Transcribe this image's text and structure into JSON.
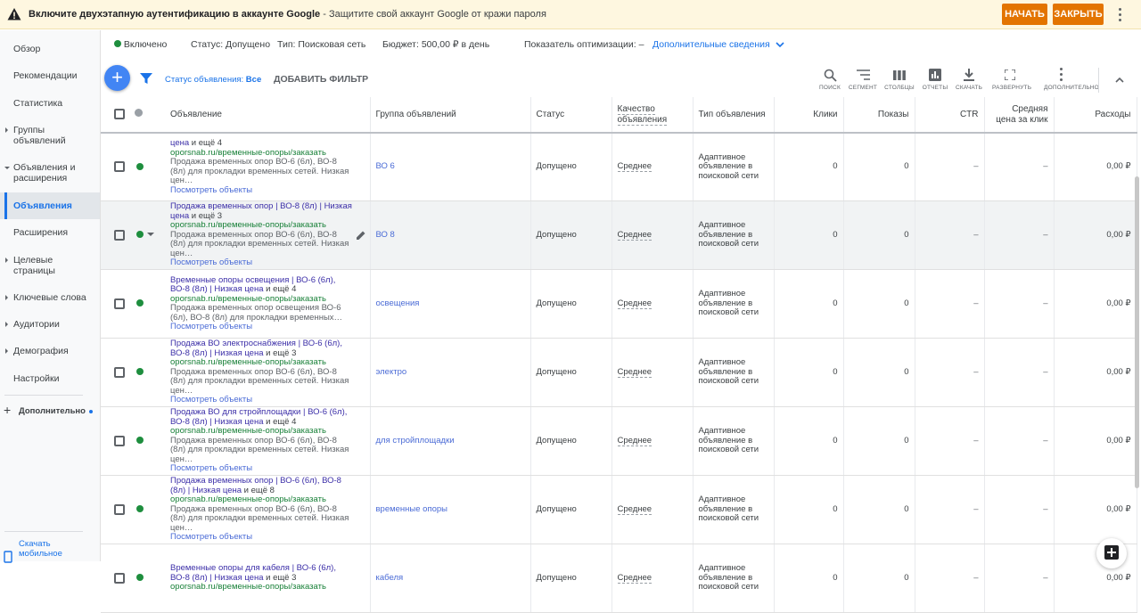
{
  "banner": {
    "title": "Включите двухэтапную аутентификацию в аккаунте Google",
    "text": " - Защитите свой аккаунт Google от кражи пароля",
    "start": "НАЧАТЬ",
    "close": "ЗАКРЫТЬ"
  },
  "sidebar": {
    "items": [
      {
        "label": "Обзор"
      },
      {
        "label": "Рекомендации"
      },
      {
        "label": "Статистика"
      },
      {
        "label": "Группы объявлений"
      },
      {
        "label": "Объявления и расширения"
      },
      {
        "label": "Объявления"
      },
      {
        "label": "Расширения"
      },
      {
        "label": "Целевые страницы"
      },
      {
        "label": "Ключевые слова"
      },
      {
        "label": "Аудитории"
      },
      {
        "label": "Демография"
      },
      {
        "label": "Настройки"
      }
    ],
    "more": "Дополнительно",
    "mobile": "Скачать мобильное"
  },
  "status": {
    "enabled": "Включено",
    "status": "Статус: Допущено",
    "type": "Тип: Поисковая сеть",
    "budget": "Бюджет: 500,00 ₽ в день",
    "optim": "Показатель оптимизации: –",
    "details": "Дополнительные сведения"
  },
  "toolbar": {
    "filter_label": "Статус объявления: ",
    "filter_value": "Все",
    "add_filter": "ДОБАВИТЬ ФИЛЬТР",
    "tools": [
      "ПОИСК",
      "СЕГМЕНТ",
      "СТОЛБЦЫ",
      "ОТЧЕТЫ",
      "СКАЧАТЬ",
      "РАЗВЕРНУТЬ",
      "ДОПОЛНИТЕЛЬНО"
    ]
  },
  "table": {
    "headers": {
      "ad": "Объявление",
      "group": "Группа объявлений",
      "status": "Статус",
      "quality": "Качество объявления",
      "type": "Тип объявления",
      "clicks": "Клики",
      "impr": "Показы",
      "ctr": "CTR",
      "cpc": "Средняя цена за клик",
      "cost": "Расходы"
    },
    "rows": [
      {
        "title": "цена",
        "more": " и ещё 4",
        "url": "oporsnab.ru/временные-опоры/заказать",
        "desc": "Продажа временных опор ВО-6 (6л), ВО-8 (8л) для прокладки временных сетей. Низкая цен…",
        "link": "Посмотреть объекты",
        "group": "ВО 6",
        "status": "Допущено",
        "quality": "Среднее",
        "type": "Адаптивное объявление в поисковой сети",
        "clicks": "0",
        "impr": "0",
        "ctr": "–",
        "cpc": "–",
        "cost": "0,00 ₽"
      },
      {
        "title": "Продажа временных опор | ВО-8 (8л) | Низкая цена",
        "more": " и ещё 3",
        "url": "oporsnab.ru/временные-опоры/заказать",
        "desc": "Продажа временных опор ВО-6 (6л), ВО-8 (8л) для прокладки временных сетей. Низкая цен…",
        "link": "Посмотреть объекты",
        "group": "ВО 8",
        "status": "Допущено",
        "quality": "Среднее",
        "type": "Адаптивное объявление в поисковой сети",
        "clicks": "0",
        "impr": "0",
        "ctr": "–",
        "cpc": "–",
        "cost": "0,00 ₽"
      },
      {
        "title": "Временные опоры освещения | ВО-6 (6л), ВО-8 (8л) | Низкая цена",
        "more": " и ещё 4",
        "url": "oporsnab.ru/временные-опоры/заказать",
        "desc": "Продажа временных опор освещения ВО-6 (6л), ВО-8 (8л) для прокладки временных…",
        "link": "Посмотреть объекты",
        "group": "освещения",
        "status": "Допущено",
        "quality": "Среднее",
        "type": "Адаптивное объявление в поисковой сети",
        "clicks": "0",
        "impr": "0",
        "ctr": "–",
        "cpc": "–",
        "cost": "0,00 ₽"
      },
      {
        "title": "Продажа ВО электроснабжения | ВО-6 (6л), ВО-8 (8л) | Низкая цена",
        "more": " и ещё 3",
        "url": "oporsnab.ru/временные-опоры/заказать",
        "desc": "Продажа временных опор ВО-6 (6л), ВО-8 (8л) для прокладки временных сетей. Низкая цен…",
        "link": "Посмотреть объекты",
        "group": "электро",
        "status": "Допущено",
        "quality": "Среднее",
        "type": "Адаптивное объявление в поисковой сети",
        "clicks": "0",
        "impr": "0",
        "ctr": "–",
        "cpc": "–",
        "cost": "0,00 ₽"
      },
      {
        "title": "Продажа ВО для стройплощадки | ВО-6 (6л), ВО-8 (8л) | Низкая цена",
        "more": " и ещё 4",
        "url": "oporsnab.ru/временные-опоры/заказать",
        "desc": "Продажа временных опор ВО-6 (6л), ВО-8 (8л) для прокладки временных сетей. Низкая цен…",
        "link": "Посмотреть объекты",
        "group": "для стройплощадки",
        "status": "Допущено",
        "quality": "Среднее",
        "type": "Адаптивное объявление в поисковой сети",
        "clicks": "0",
        "impr": "0",
        "ctr": "–",
        "cpc": "–",
        "cost": "0,00 ₽"
      },
      {
        "title": "Продажа временных опор | ВО-6 (6л), ВО-8 (8л) | Низкая цена",
        "more": " и ещё 8",
        "url": "oporsnab.ru/временные-опоры/заказать",
        "desc": "Продажа временных опор ВО-6 (6л), ВО-8 (8л) для прокладки временных сетей. Низкая цен…",
        "link": "Посмотреть объекты",
        "group": "временные опоры",
        "status": "Допущено",
        "quality": "Среднее",
        "type": "Адаптивное объявление в поисковой сети",
        "clicks": "0",
        "impr": "0",
        "ctr": "–",
        "cpc": "–",
        "cost": "0,00 ₽"
      },
      {
        "title": "Временные опоры для кабеля | ВО-6 (6л), ВО-8 (8л) | Низкая цена",
        "more": " и ещё 3",
        "url": "oporsnab.ru/временные-опоры/заказать",
        "desc": "",
        "link": "",
        "group": "кабеля",
        "status": "Допущено",
        "quality": "Среднее",
        "type": "Адаптивное объявление в поисковой сети",
        "clicks": "0",
        "impr": "0",
        "ctr": "–",
        "cpc": "–",
        "cost": "0,00 ₽"
      }
    ]
  },
  "colors": {
    "accent": "#1a73e8",
    "warning": "#e37400",
    "enabled": "#1e8e3e",
    "banner_bg": "#fef7e0"
  }
}
